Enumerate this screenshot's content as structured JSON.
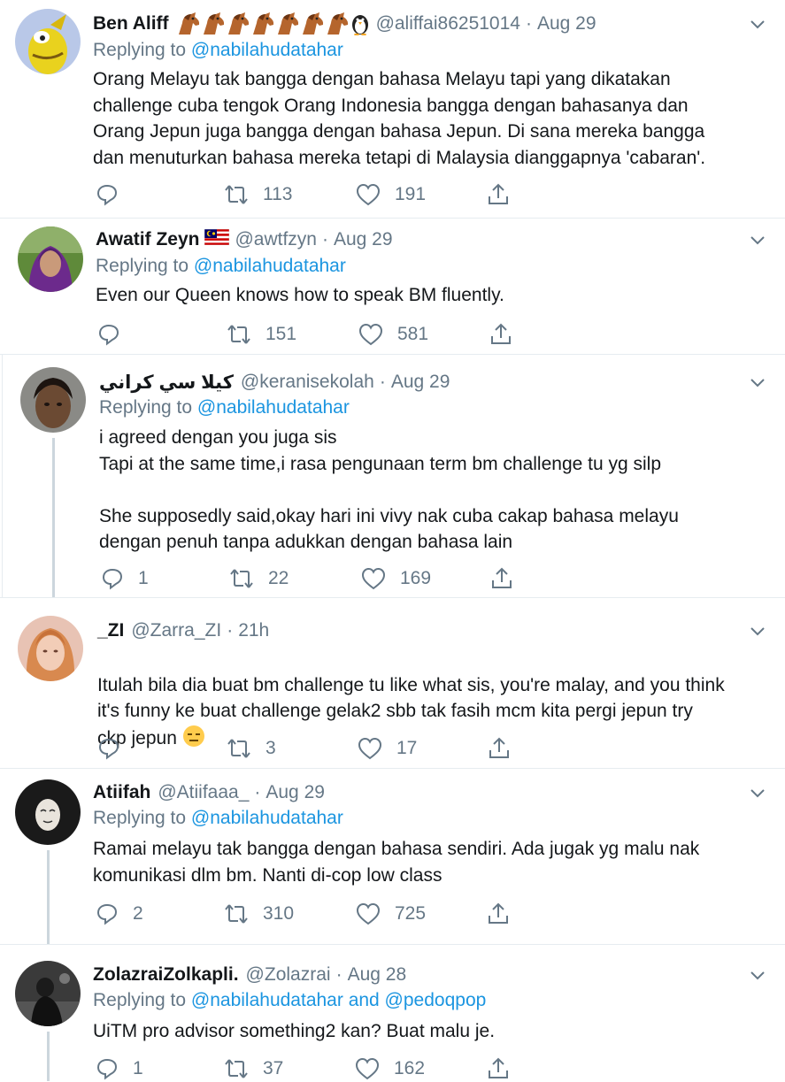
{
  "tweets": [
    {
      "name": "Ben Aliff",
      "handle": "@aliffai86251014",
      "date": "Aug 29",
      "replying_prefix": "Replying to",
      "replying_to": "@nabilahudatahar",
      "text": "Orang Melayu tak bangga dengan bahasa Melayu tapi yang dikatakan\nchallenge cuba tengok Orang Indonesia bangga dengan bahasanya dan\nOrang Jepun juga bangga dengan bahasa Jepun. Di sana mereka bangga\ndan menuturkan bahasa mereka tetapi di Malaysia dianggapnya 'cabaran'.",
      "reply_count": "",
      "retweet_count": "113",
      "like_count": "191"
    },
    {
      "name": "Awatif Zeyn",
      "handle": "@awtfzyn",
      "date": "Aug 29",
      "replying_prefix": "Replying to",
      "replying_to": "@nabilahudatahar",
      "text": "Even our Queen knows how to speak BM fluently.",
      "reply_count": "",
      "retweet_count": "151",
      "like_count": "581"
    },
    {
      "name": "كيلا سي كراني",
      "handle": "@keranisekolah",
      "date": "Aug 29",
      "replying_prefix": "Replying to",
      "replying_to": "@nabilahudatahar",
      "text": "i agreed dengan you juga sis\nTapi at the same time,i rasa pengunaan term bm challenge tu yg silp\n\nShe supposedly said,okay hari ini vivy nak cuba cakap bahasa melayu\ndengan penuh tanpa adukkan dengan bahasa lain",
      "reply_count": "1",
      "retweet_count": "22",
      "like_count": "169"
    },
    {
      "name": "_ZI",
      "handle": "@Zarra_ZI",
      "date": "21h",
      "replying_prefix": "",
      "replying_to": "",
      "text": "Itulah bila dia buat bm challenge tu like what sis, you're malay, and you think\nit's funny ke buat challenge gelak2 sbb tak fasih mcm kita pergi jepun try\nckp jepun",
      "reply_count": "",
      "retweet_count": "3",
      "like_count": "17"
    },
    {
      "name": "Atiifah",
      "handle": "@Atiifaaa_",
      "date": "Aug 29",
      "replying_prefix": "Replying to",
      "replying_to": "@nabilahudatahar",
      "text": "Ramai melayu tak bangga dengan bahasa sendiri. Ada jugak yg malu nak\nkomunikasi dlm bm. Nanti di-cop low class",
      "reply_count": "2",
      "retweet_count": "310",
      "like_count": "725"
    },
    {
      "name": "ZolazraiZolkapli.",
      "handle": "@Zolazrai",
      "date": "Aug 28",
      "replying_prefix": "Replying to",
      "replying_to": "@nabilahudatahar and @pedoqpop",
      "text": "UiTM pro advisor something2 kan? Buat malu je.",
      "reply_count": "1",
      "retweet_count": "37",
      "like_count": "162"
    }
  ],
  "separator": "·",
  "colors": {
    "link": "#1b95e0",
    "secondary_text": "#657786",
    "primary_text": "#14171a",
    "divider": "#e6ecf0",
    "thread_line": "#ccd6dd"
  },
  "icons": {
    "reply": "reply-icon",
    "retweet": "retweet-icon",
    "like": "like-icon",
    "share": "share-icon",
    "caret": "chevron-down-icon",
    "horse_emoji": "horse-emoji-icon",
    "penguin_emoji": "penguin-emoji-icon",
    "malaysia_flag": "malaysia-flag-icon",
    "expressionless_face": "expressionless-face-emoji-icon"
  }
}
